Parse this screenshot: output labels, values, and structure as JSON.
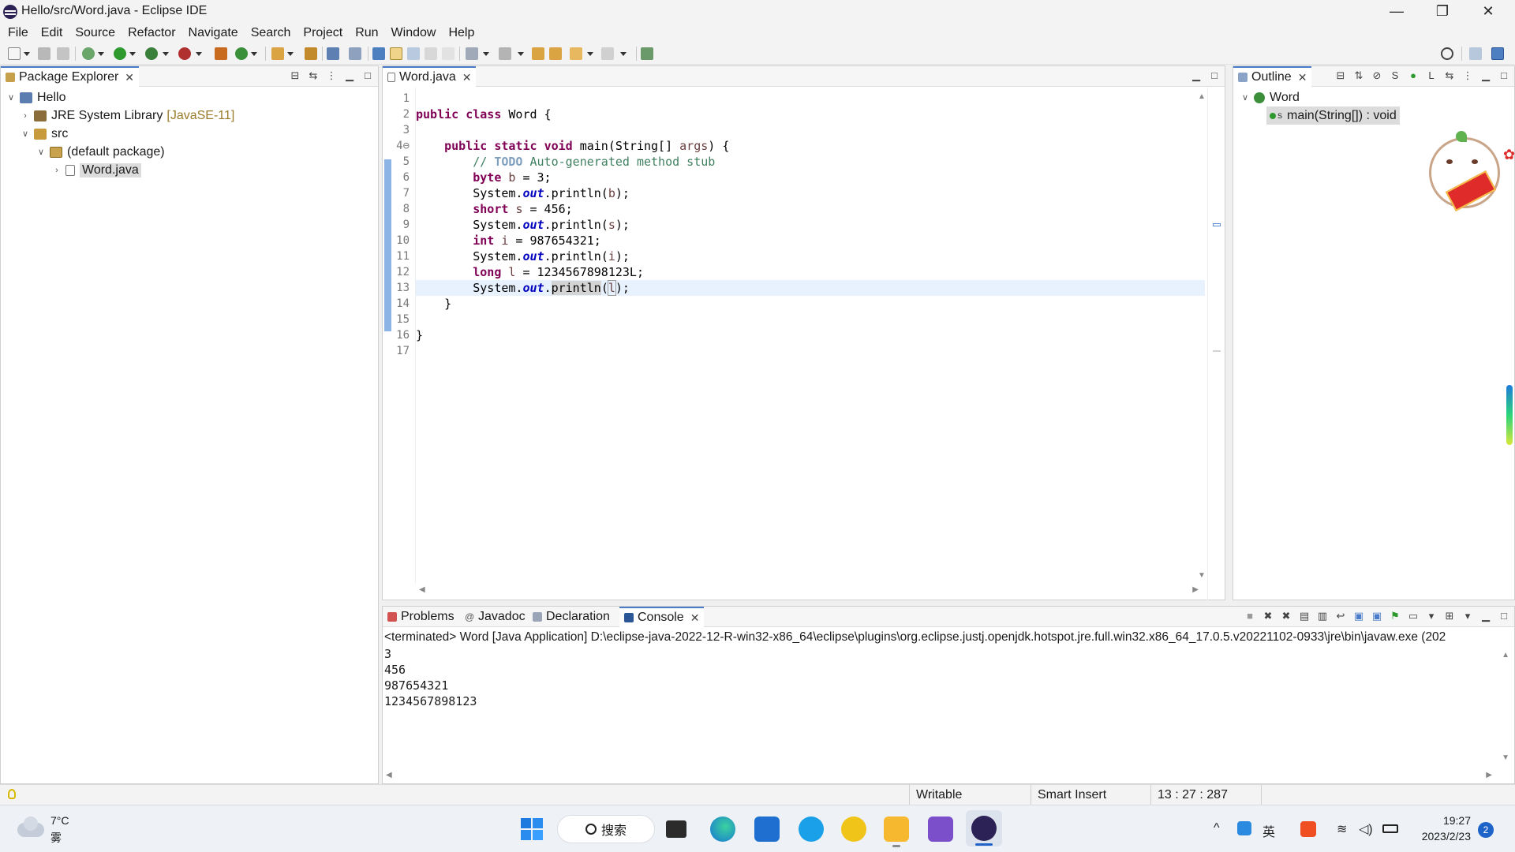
{
  "window": {
    "title": "Hello/src/Word.java - Eclipse IDE",
    "minimize": "—",
    "maximize": "❐",
    "close": "✕"
  },
  "menu": [
    "File",
    "Edit",
    "Source",
    "Refactor",
    "Navigate",
    "Search",
    "Project",
    "Run",
    "Window",
    "Help"
  ],
  "package_explorer": {
    "tab_label": "Package Explorer",
    "tree": [
      {
        "label": "Hello",
        "decoration": ""
      },
      {
        "label": "JRE System Library",
        "decoration": "[JavaSE-11]"
      },
      {
        "label": "src",
        "decoration": ""
      },
      {
        "label": "(default package)",
        "decoration": ""
      },
      {
        "label": "Word.java",
        "decoration": ""
      }
    ]
  },
  "editor": {
    "tab_label": "Word.java",
    "line_numbers": [
      "1",
      "2",
      "3",
      "4⊖",
      "5",
      "6",
      "7",
      "8",
      "9",
      "10",
      "11",
      "12",
      "13",
      "14",
      "15",
      "16",
      "17"
    ],
    "lines": [
      "",
      "public class Word {",
      "",
      "    public static void main(String[] args) {",
      "        // TODO Auto-generated method stub",
      "        byte b = 3;",
      "        System.out.println(b);",
      "        short s = 456;",
      "        System.out.println(s);",
      "        int i = 987654321;",
      "        System.out.println(i);",
      "        long l = 1234567898123L;",
      "        System.out.println(l);",
      "    }",
      "",
      "}",
      ""
    ]
  },
  "outline": {
    "tab_label": "Outline",
    "class_name": "Word",
    "method_signature": "main(String[]) : void",
    "method_modifier": "S"
  },
  "bottom_tabs": {
    "problems": "Problems",
    "javadoc": "Javadoc",
    "declaration": "Declaration",
    "console": "Console"
  },
  "console": {
    "terminated": "<terminated> Word [Java Application] D:\\eclipse-java-2022-12-R-win32-x86_64\\eclipse\\plugins\\org.eclipse.justj.openjdk.hotspot.jre.full.win32.x86_64_17.0.5.v20221102-0933\\jre\\bin\\javaw.exe  (202",
    "output": [
      "3",
      "456",
      "987654321",
      "1234567898123"
    ]
  },
  "status": {
    "writable": "Writable",
    "insert_mode": "Smart Insert",
    "position": "13 : 27 : 287"
  },
  "taskbar": {
    "weather_temp": "7°C",
    "weather_desc": "雾",
    "search_label": "搜索",
    "time": "19:27",
    "date": "2023/2/23",
    "notification_count": "2"
  },
  "colors": {
    "keyword": "#7f0055",
    "comment": "#3f7f5f",
    "field": "#0000c0",
    "current_line": "#e8f2fe",
    "active_tab_accent": "#4a7cc9"
  }
}
